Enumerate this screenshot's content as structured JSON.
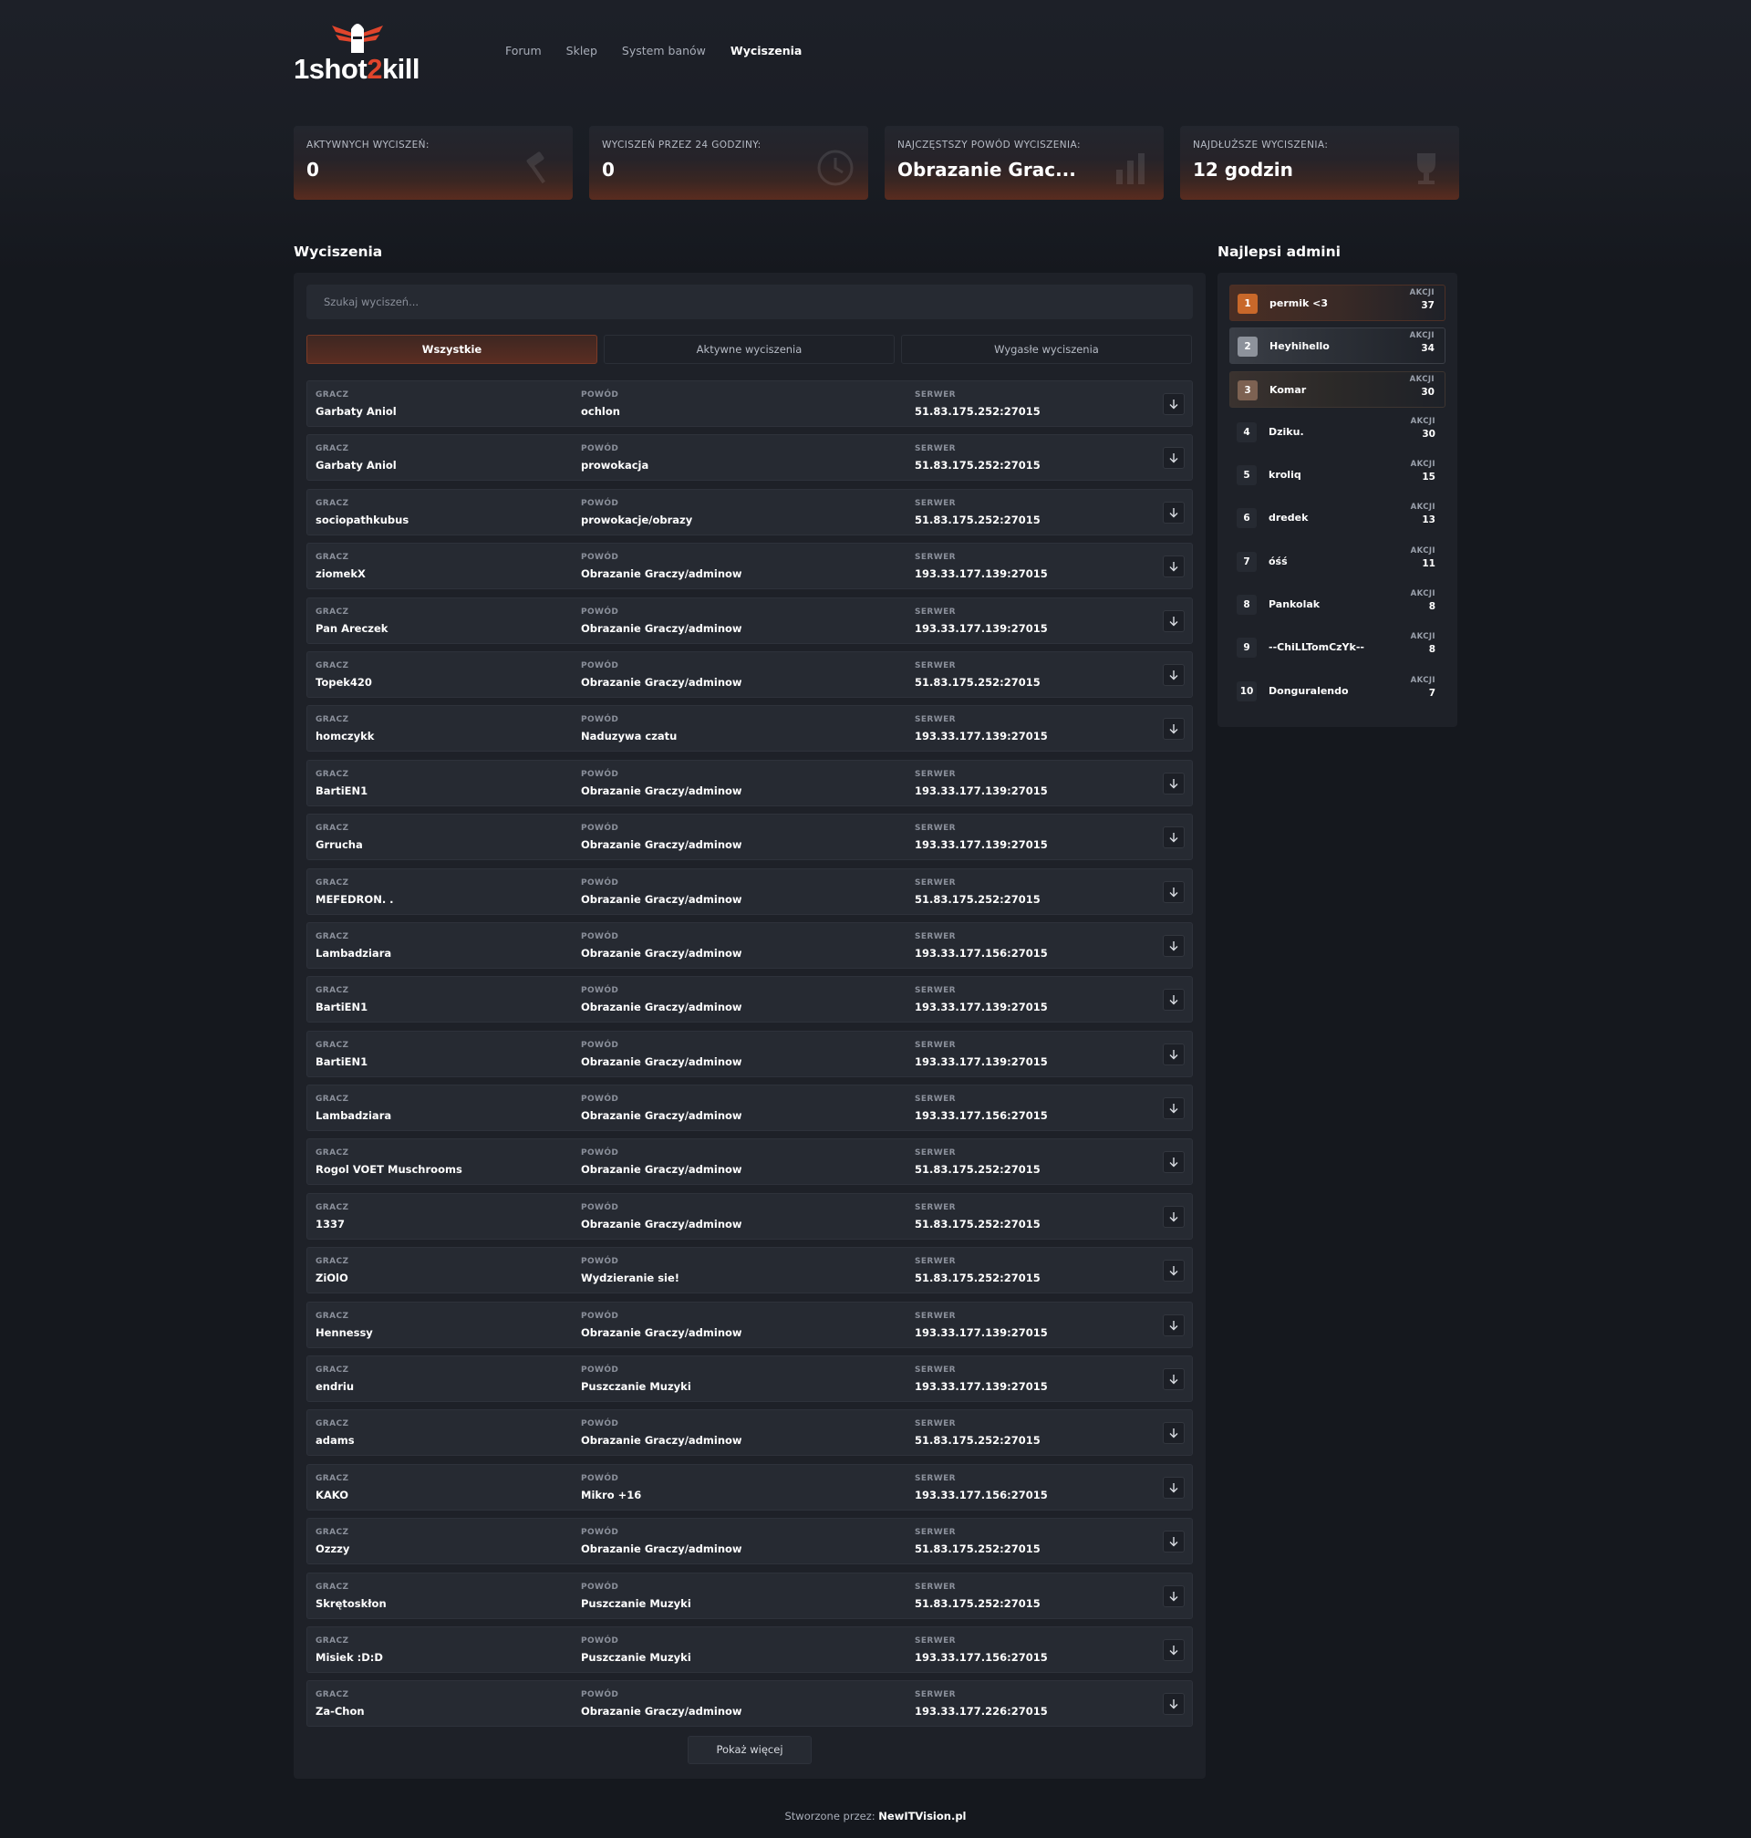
{
  "brand": {
    "name_part1": "1shot",
    "name_accent": "2",
    "name_part2": "kill"
  },
  "nav": [
    {
      "label": "Forum",
      "active": false
    },
    {
      "label": "Sklep",
      "active": false
    },
    {
      "label": "System banów",
      "active": false
    },
    {
      "label": "Wyciszenia",
      "active": true
    }
  ],
  "stats": [
    {
      "label": "AKTYWNYCH WYCISZEŃ:",
      "value": "0",
      "icon": "gavel-icon"
    },
    {
      "label": "WYCISZEŃ PRZEZ 24 GODZINY:",
      "value": "0",
      "icon": "clock-icon"
    },
    {
      "label": "NAJCZĘSTSZY POWÓD WYCISZENIA:",
      "value": "Obrazanie Grac...",
      "icon": "chart-icon"
    },
    {
      "label": "NAJDŁUŻSZE WYCISZENIA:",
      "value": "12 godzin",
      "icon": "trophy-icon"
    }
  ],
  "mutes": {
    "title": "Wyciszenia",
    "search_placeholder": "Szukaj wyciszeń...",
    "tabs": [
      {
        "label": "Wszystkie",
        "active": true
      },
      {
        "label": "Aktywne wyciszenia",
        "active": false
      },
      {
        "label": "Wygasłe wyciszenia",
        "active": false
      }
    ],
    "col_player": "GRACZ",
    "col_reason": "POWÓD",
    "col_server": "SERWER",
    "rows": [
      {
        "player": "Garbaty Aniol",
        "reason": "ochlon",
        "server": "51.83.175.252:27015"
      },
      {
        "player": "Garbaty Aniol",
        "reason": "prowokacja",
        "server": "51.83.175.252:27015"
      },
      {
        "player": "sociopathkubus",
        "reason": "prowokacje/obrazy",
        "server": "51.83.175.252:27015"
      },
      {
        "player": "ziomekX",
        "reason": "Obrazanie Graczy/adminow",
        "server": "193.33.177.139:27015"
      },
      {
        "player": "Pan Areczek",
        "reason": "Obrazanie Graczy/adminow",
        "server": "193.33.177.139:27015"
      },
      {
        "player": "Topek420",
        "reason": "Obrazanie Graczy/adminow",
        "server": "51.83.175.252:27015"
      },
      {
        "player": "homczykk",
        "reason": "Naduzywa czatu",
        "server": "193.33.177.139:27015"
      },
      {
        "player": "BartiEN1",
        "reason": "Obrazanie Graczy/adminow",
        "server": "193.33.177.139:27015"
      },
      {
        "player": "Grrucha",
        "reason": "Obrazanie Graczy/adminow",
        "server": "193.33.177.139:27015"
      },
      {
        "player": "MEFEDRON. .",
        "reason": "Obrazanie Graczy/adminow",
        "server": "51.83.175.252:27015"
      },
      {
        "player": "Lambadziara",
        "reason": "Obrazanie Graczy/adminow",
        "server": "193.33.177.156:27015"
      },
      {
        "player": "BartiEN1",
        "reason": "Obrazanie Graczy/adminow",
        "server": "193.33.177.139:27015"
      },
      {
        "player": "BartiEN1",
        "reason": "Obrazanie Graczy/adminow",
        "server": "193.33.177.139:27015"
      },
      {
        "player": "Lambadziara",
        "reason": "Obrazanie Graczy/adminow",
        "server": "193.33.177.156:27015"
      },
      {
        "player": "Rogol VOET Muschrooms",
        "reason": "Obrazanie Graczy/adminow",
        "server": "51.83.175.252:27015"
      },
      {
        "player": "1337",
        "reason": "Obrazanie Graczy/adminow",
        "server": "51.83.175.252:27015"
      },
      {
        "player": "ZiOlO",
        "reason": "Wydzieranie sie!",
        "server": "51.83.175.252:27015"
      },
      {
        "player": "Hennessy",
        "reason": "Obrazanie Graczy/adminow",
        "server": "193.33.177.139:27015"
      },
      {
        "player": "endriu",
        "reason": "Puszczanie Muzyki",
        "server": "193.33.177.139:27015"
      },
      {
        "player": "adams",
        "reason": "Obrazanie Graczy/adminow",
        "server": "51.83.175.252:27015"
      },
      {
        "player": "KAKO",
        "reason": "Mikro +16",
        "server": "193.33.177.156:27015"
      },
      {
        "player": "Ozzzy",
        "reason": "Obrazanie Graczy/adminow",
        "server": "51.83.175.252:27015"
      },
      {
        "player": "Skrętoskłon",
        "reason": "Puszczanie Muzyki",
        "server": "51.83.175.252:27015"
      },
      {
        "player": "Misiek :D:D",
        "reason": "Puszczanie Muzyki",
        "server": "193.33.177.156:27015"
      },
      {
        "player": "Za-Chon",
        "reason": "Obrazanie Graczy/adminow",
        "server": "193.33.177.226:27015"
      }
    ],
    "show_more": "Pokaż więcej"
  },
  "admins": {
    "title": "Najlepsi admini",
    "actions_label": "AKCJI",
    "list": [
      {
        "rank": "1",
        "name": "permik <3",
        "actions": "37"
      },
      {
        "rank": "2",
        "name": "Heyhihello",
        "actions": "34"
      },
      {
        "rank": "3",
        "name": "Komar",
        "actions": "30"
      },
      {
        "rank": "4",
        "name": "Dziku.",
        "actions": "30"
      },
      {
        "rank": "5",
        "name": "kroliq",
        "actions": "15"
      },
      {
        "rank": "6",
        "name": "dredek",
        "actions": "13"
      },
      {
        "rank": "7",
        "name": "óśś",
        "actions": "11"
      },
      {
        "rank": "8",
        "name": "Pankolak",
        "actions": "8"
      },
      {
        "rank": "9",
        "name": "--ChiLLTomCzYk--",
        "actions": "8"
      },
      {
        "rank": "10",
        "name": "Donguralendo",
        "actions": "7"
      }
    ]
  },
  "footer": {
    "prefix": "Stworzone przez:",
    "author": "NewITVision.pl"
  },
  "colors": {
    "accent": "#e0452c",
    "background": "#15181e",
    "panel": "#1e2128",
    "row": "#262a32",
    "gold": "#c8682a"
  }
}
